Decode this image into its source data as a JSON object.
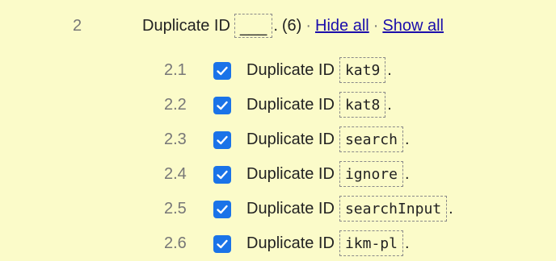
{
  "group": {
    "number": "2",
    "label": "Duplicate ID",
    "blank": "___",
    "count": "(6)",
    "separator": "·",
    "hide_all": "Hide all",
    "show_all": "Show all"
  },
  "items": [
    {
      "number": "2.1",
      "label": "Duplicate ID",
      "code": "kat9",
      "checked": true
    },
    {
      "number": "2.2",
      "label": "Duplicate ID",
      "code": "kat8",
      "checked": true
    },
    {
      "number": "2.3",
      "label": "Duplicate ID",
      "code": "search",
      "checked": true
    },
    {
      "number": "2.4",
      "label": "Duplicate ID",
      "code": "ignore",
      "checked": true
    },
    {
      "number": "2.5",
      "label": "Duplicate ID",
      "code": "searchInput",
      "checked": true
    },
    {
      "number": "2.6",
      "label": "Duplicate ID",
      "code": "ikm-pl",
      "checked": true
    }
  ],
  "colors": {
    "background": "#fbfbc9",
    "checkbox": "#1a73e8",
    "link": "#1a0dab"
  }
}
